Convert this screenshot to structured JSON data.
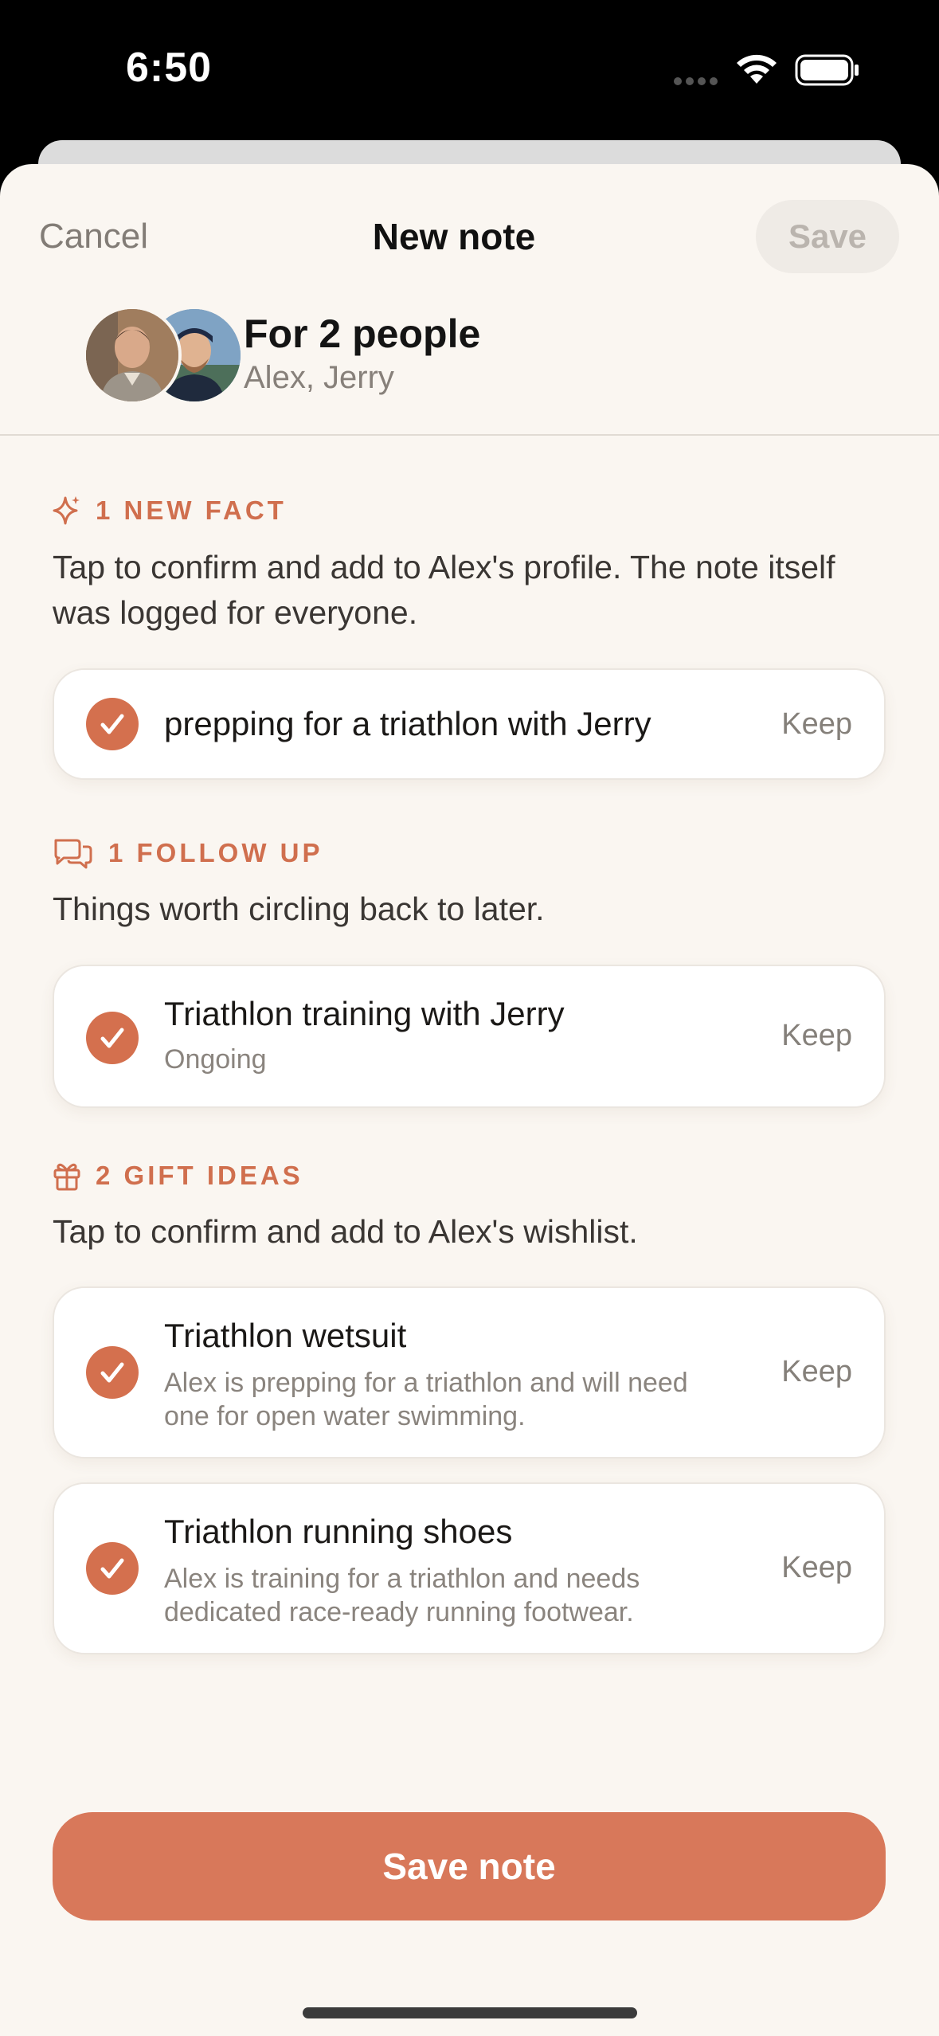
{
  "status_bar": {
    "time": "6:50"
  },
  "nav": {
    "cancel": "Cancel",
    "title": "New note",
    "save": "Save"
  },
  "recipients": {
    "title": "For 2 people",
    "names": "Alex, Jerry"
  },
  "sections": {
    "fact": {
      "header": "1 NEW FACT",
      "description": "Tap to confirm and add to Alex's profile. The note itself was logged for everyone.",
      "items": [
        {
          "title": "prepping for a triathlon with Jerry",
          "action": "Keep"
        }
      ]
    },
    "follow_up": {
      "header": "1 FOLLOW UP",
      "description": "Things worth circling back to later.",
      "items": [
        {
          "title": "Triathlon training with Jerry",
          "subtitle": "Ongoing",
          "action": "Keep"
        }
      ]
    },
    "gifts": {
      "header": "2 GIFT IDEAS",
      "description": "Tap to confirm and add to Alex's wishlist.",
      "items": [
        {
          "title": "Triathlon wetsuit",
          "subtitle": "Alex is prepping for a triathlon and will need one for open water swimming.",
          "action": "Keep"
        },
        {
          "title": "Triathlon running shoes",
          "subtitle": "Alex is training for a triathlon and needs dedicated race-ready running footwear.",
          "action": "Keep"
        }
      ]
    }
  },
  "footer": {
    "save_note": "Save note"
  },
  "colors": {
    "accent": "#d8785a",
    "background": "#faf6f1",
    "section_header": "#d06f4e"
  }
}
